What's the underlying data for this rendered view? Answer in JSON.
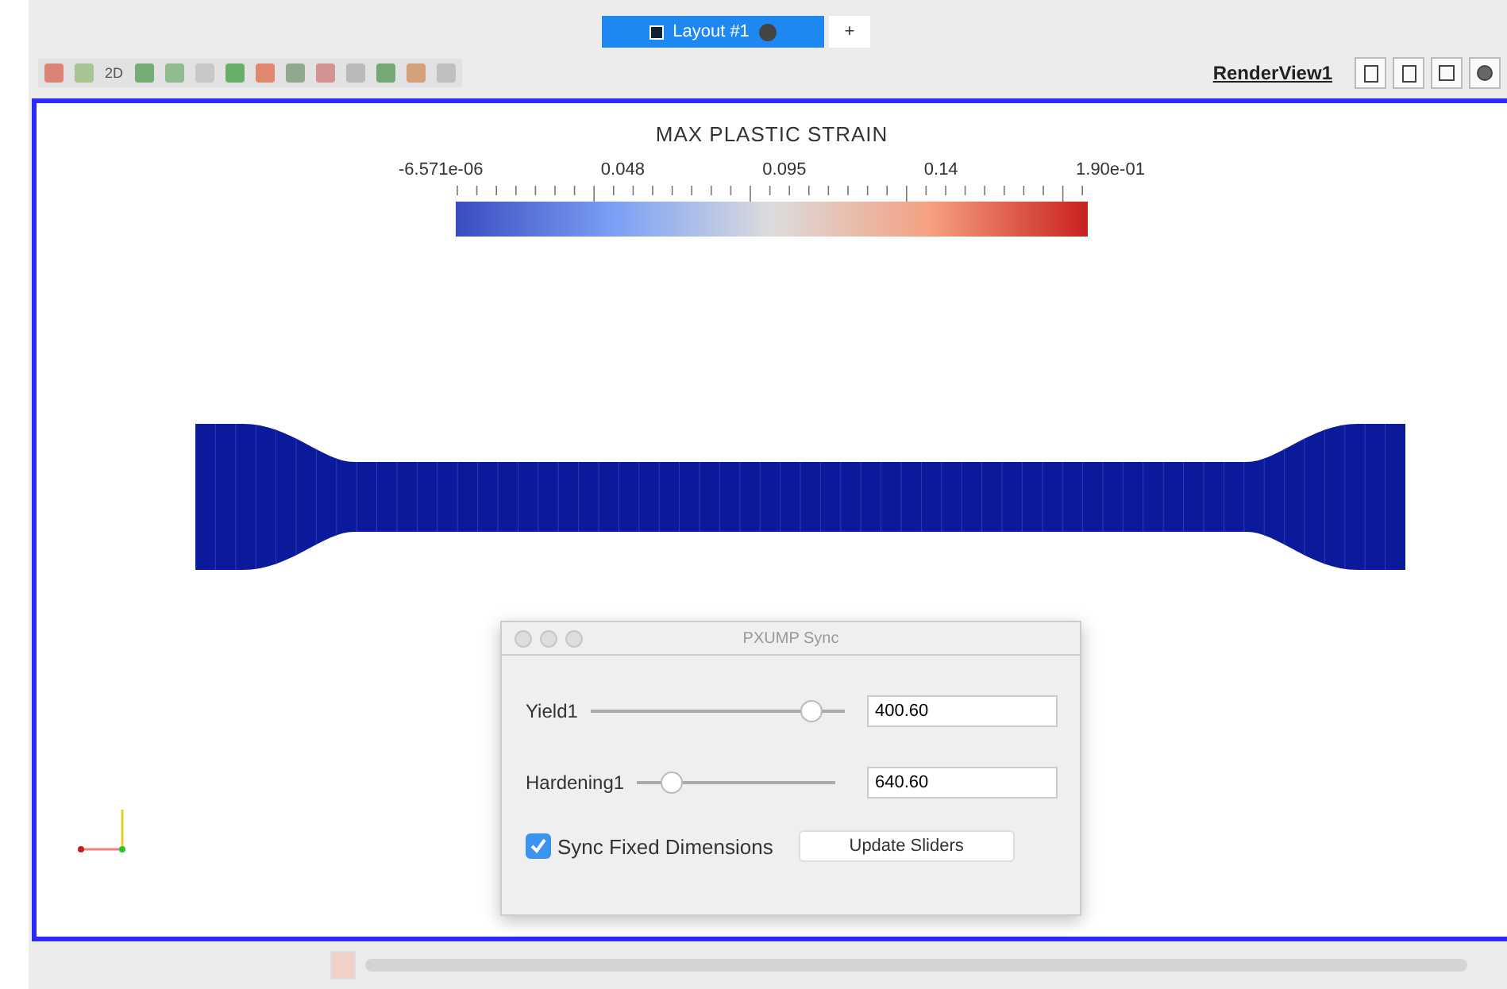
{
  "tabs": [
    {
      "label": "Layout #1",
      "selected": true
    },
    {
      "label": "+",
      "selected": false
    }
  ],
  "toolbar": {
    "text_button": "2D"
  },
  "view_name": "RenderView1",
  "colorbar": {
    "title": "MAX PLASTIC STRAIN",
    "labels": [
      "-6.571e-06",
      "0.048",
      "0.095",
      "0.14",
      "1.90e-01"
    ]
  },
  "dialog": {
    "title": "PXUMP Sync",
    "sliders": [
      {
        "label": "Yield1",
        "level": 0.86,
        "value": "400.60"
      },
      {
        "label": "Hardening1",
        "level": 0.17,
        "value": "640.60"
      }
    ],
    "checkbox": {
      "label": "Sync Fixed Dimensions",
      "checked": true
    },
    "button": "Update Sliders"
  }
}
